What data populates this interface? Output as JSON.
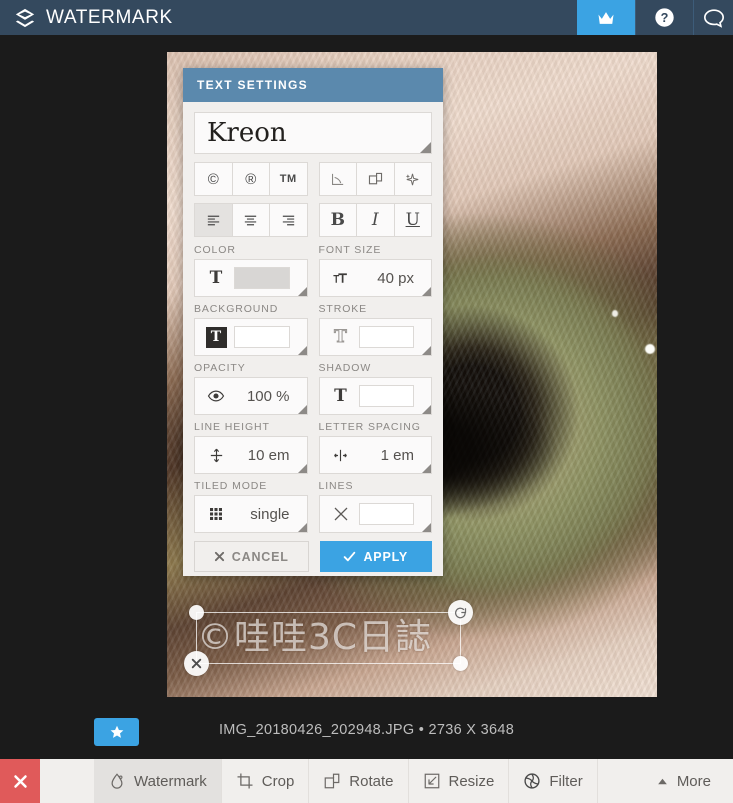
{
  "topbar": {
    "logo_icon": "diamond-layers-icon",
    "title": "WATERMARK",
    "premium_icon": "crown-icon",
    "premium_label": "Premium",
    "help_icon": "question-circle-icon",
    "help_label": "Help",
    "chat_icon": "chat-bubble-icon",
    "chat_label": "Chat",
    "bg_color": "#34495e",
    "accent_color": "#3ba3e3"
  },
  "panel": {
    "header_title": "TEXT SETTINGS",
    "header_color": "#5b89ad",
    "font_name": "Kreon",
    "symbol_buttons": [
      {
        "name": "copyright-symbol-button",
        "glyph": "©",
        "label": "Copyright"
      },
      {
        "name": "registered-symbol-button",
        "glyph": "®",
        "label": "Registered"
      },
      {
        "name": "trademark-symbol-button",
        "glyph": "TM",
        "label": "Trademark"
      }
    ],
    "transform_buttons": [
      {
        "name": "perspective-icon",
        "label": "Perspective"
      },
      {
        "name": "duplicate-icon",
        "label": "Duplicate"
      },
      {
        "name": "sparkle-effect-icon",
        "label": "Effects"
      }
    ],
    "align_buttons": [
      {
        "name": "align-left-icon",
        "label": "Align left",
        "active": true
      },
      {
        "name": "align-center-icon",
        "label": "Align center",
        "active": false
      },
      {
        "name": "align-right-icon",
        "label": "Align right",
        "active": false
      }
    ],
    "style_buttons": [
      {
        "name": "bold-button",
        "glyph": "B",
        "label": "Bold"
      },
      {
        "name": "italic-button",
        "glyph": "I",
        "label": "Italic"
      },
      {
        "name": "underline-button",
        "glyph": "U",
        "label": "Underline"
      }
    ],
    "fields": [
      {
        "label": "COLOR",
        "icon": "text-color-icon",
        "kind": "swatch",
        "swatch_color": "#d8d6d4",
        "value": ""
      },
      {
        "label": "FONT SIZE",
        "icon": "font-size-icon",
        "kind": "value",
        "value": "40 px"
      },
      {
        "label": "BACKGROUND",
        "icon": "text-background-icon",
        "kind": "swatch",
        "swatch_color": "#ffffff",
        "value": ""
      },
      {
        "label": "STROKE",
        "icon": "text-stroke-icon",
        "kind": "swatch",
        "swatch_color": "#ffffff",
        "value": ""
      },
      {
        "label": "OPACITY",
        "icon": "eye-icon",
        "kind": "value",
        "value": "100 %"
      },
      {
        "label": "SHADOW",
        "icon": "text-shadow-icon",
        "kind": "swatch",
        "swatch_color": "#ffffff",
        "value": ""
      },
      {
        "label": "LINE HEIGHT",
        "icon": "line-height-icon",
        "kind": "value",
        "value": "10 em"
      },
      {
        "label": "LETTER SPACING",
        "icon": "letter-spacing-icon",
        "kind": "value",
        "value": "1 em"
      },
      {
        "label": "TILED MODE",
        "icon": "grid-tile-icon",
        "kind": "value",
        "value": "single"
      },
      {
        "label": "LINES",
        "icon": "cross-lines-icon",
        "kind": "swatch",
        "swatch_color": "#ffffff",
        "value": ""
      }
    ],
    "cancel_label": "CANCEL",
    "cancel_icon": "cross-icon",
    "apply_label": "APPLY",
    "apply_icon": "check-icon",
    "apply_color": "#3ba3e3"
  },
  "watermark_overlay": {
    "text": "©哇哇3C日誌",
    "rotate_icon": "rotate-handle-icon",
    "delete_icon": "delete-handle-icon",
    "resize_handle_icon": "resize-dot-icon"
  },
  "meta": {
    "star_icon": "star-icon",
    "star_label": "Favorite",
    "file_info": "IMG_20180426_202948.JPG • 2736 X 3648"
  },
  "bottombar": {
    "close_icon": "close-icon",
    "close_label": "Close",
    "close_color": "#e05a5a",
    "tools": [
      {
        "name": "tool-watermark",
        "label": "Watermark",
        "icon": "droplet-icon",
        "active": true
      },
      {
        "name": "tool-crop",
        "label": "Crop",
        "icon": "crop-icon",
        "active": false
      },
      {
        "name": "tool-rotate",
        "label": "Rotate",
        "icon": "rotate-icon",
        "active": false
      },
      {
        "name": "tool-resize",
        "label": "Resize",
        "icon": "resize-icon",
        "active": false
      },
      {
        "name": "tool-filter",
        "label": "Filter",
        "icon": "aperture-icon",
        "active": false
      },
      {
        "name": "tool-more",
        "label": "More",
        "icon": "caret-up-icon",
        "active": false
      }
    ]
  }
}
